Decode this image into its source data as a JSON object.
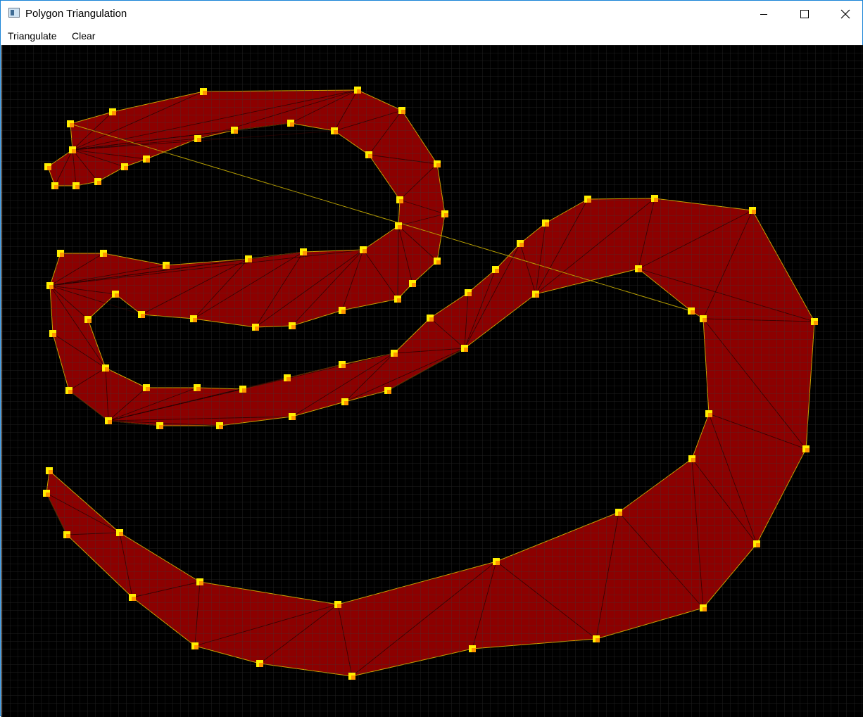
{
  "window": {
    "title": "Polygon Triangulation"
  },
  "menu": {
    "triangulate": "Triangulate",
    "clear": "Clear"
  },
  "colors": {
    "background": "#000000",
    "grid": "#3a3a3a",
    "fill": "#8c0000",
    "outline": "#c9a400",
    "diagonal": "#2a0000",
    "vertex": "#ffee00",
    "vertex_active": "#ff8000",
    "guide_line": "#b8a000"
  }
}
